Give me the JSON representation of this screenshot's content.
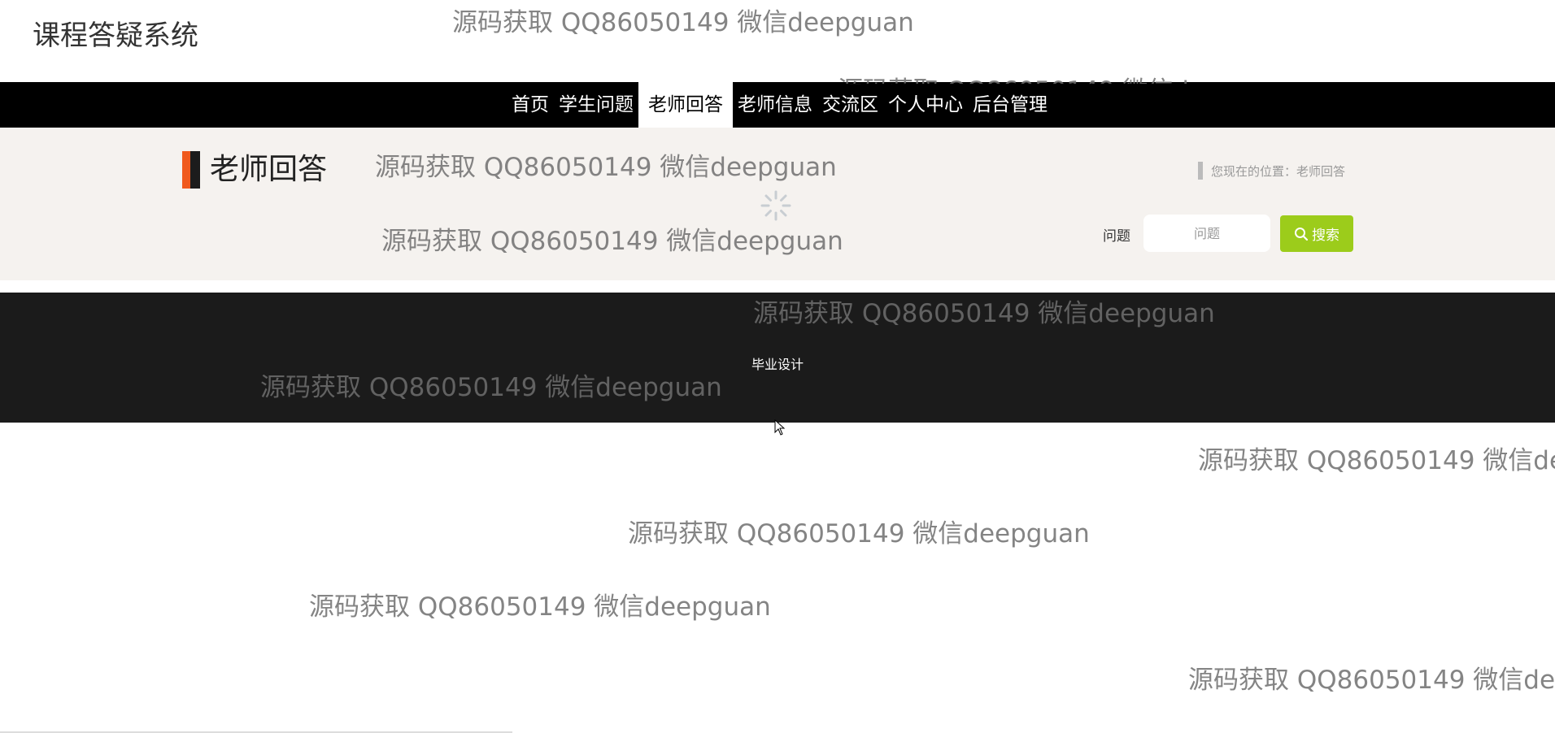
{
  "site": {
    "title": "课程答疑系统"
  },
  "nav": {
    "items": [
      {
        "label": "首页",
        "active": false
      },
      {
        "label": "学生问题",
        "active": false
      },
      {
        "label": "老师回答",
        "active": true
      },
      {
        "label": "老师信息",
        "active": false
      },
      {
        "label": "交流区",
        "active": false
      },
      {
        "label": "个人中心",
        "active": false
      },
      {
        "label": "后台管理",
        "active": false
      }
    ]
  },
  "page": {
    "heading": "老师回答",
    "breadcrumb": "您现在的位置：老师回答"
  },
  "search": {
    "label": "问题",
    "placeholder": "问题",
    "button_label": "搜索"
  },
  "footer": {
    "text": "毕业设计"
  },
  "watermark": {
    "text": "源码获取 QQ86050149 微信deepguan"
  },
  "colors": {
    "nav_bg": "#000000",
    "banner_bg": "#f5f2ef",
    "accent_orange": "#f05a1e",
    "search_button": "#9ccc1b",
    "footer_bg": "#1b1b1b"
  }
}
